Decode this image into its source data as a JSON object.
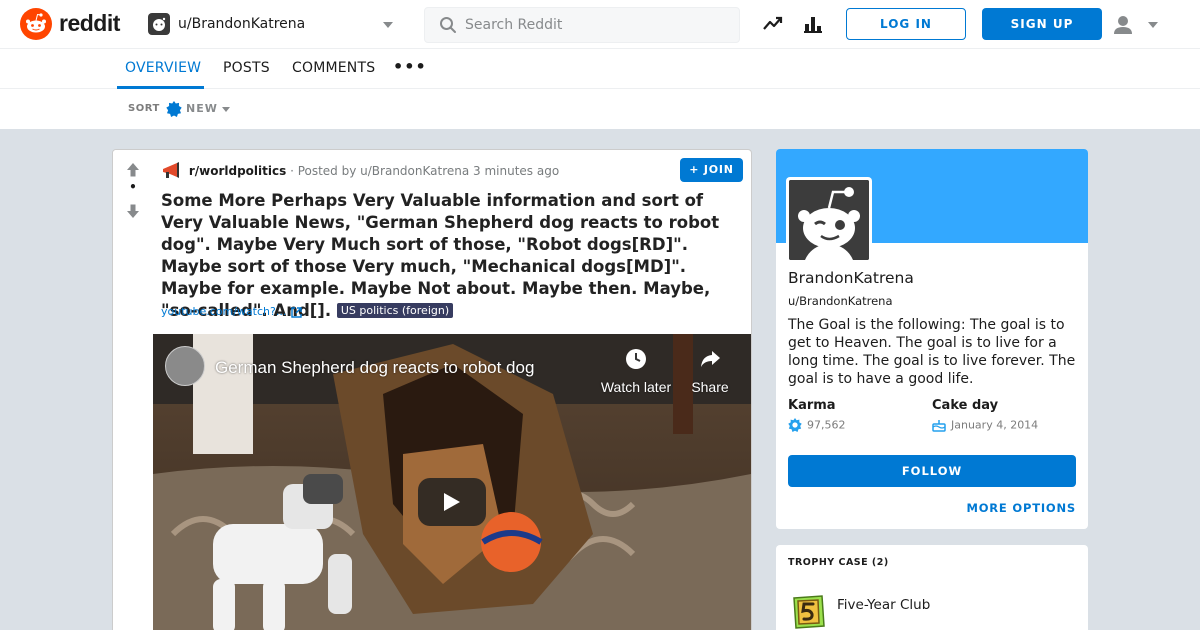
{
  "header": {
    "logo_text": "reddit",
    "current_user": "u/BrandonKatrena",
    "search_placeholder": "Search Reddit",
    "login_label": "LOG IN",
    "signup_label": "SIGN UP"
  },
  "tabs": {
    "items": [
      "OVERVIEW",
      "POSTS",
      "COMMENTS"
    ],
    "active": "OVERVIEW",
    "more": "•••"
  },
  "sort": {
    "label": "SORT",
    "value": "NEW"
  },
  "post": {
    "score": "•",
    "subreddit": "r/worldpolitics",
    "byline": " · Posted by u/BrandonKatrena 3 minutes ago",
    "join_label": "+ JOIN",
    "title": "Some More Perhaps Very Valuable information and sort of Very Valuable News, \"German Shepherd dog reacts to robot dog\". Maybe Very Much sort of those, \"Robot dogs[RD]\". Maybe sort of those Very much, \"Mechanical dogs[MD]\". Maybe for example. Maybe Not about. Maybe then. Maybe, \"so-called\". And[].",
    "flair": "US politics (foreign)",
    "link_text": "youtube.com/watch?...",
    "video": {
      "title": "German Shepherd dog reacts to robot dog",
      "watch_later": "Watch later",
      "share": "Share"
    }
  },
  "profile": {
    "display_name": "BrandonKatrena",
    "handle": "u/BrandonKatrena",
    "description": "The Goal is the following: The goal is to get to Heaven. The goal is to live for a long time. The goal is to live forever. The goal is to have a good life.",
    "karma_label": "Karma",
    "karma_value": "97,562",
    "cakeday_label": "Cake day",
    "cakeday_value": "January 4, 2014",
    "follow_label": "FOLLOW",
    "more_options_label": "MORE OPTIONS",
    "banner_color": "#33a8ff"
  },
  "trophy_case": {
    "heading": "TROPHY CASE (2)",
    "items": [
      {
        "name": "Five-Year Club",
        "icon": "five-year-club-icon"
      }
    ]
  },
  "colors": {
    "accent": "#0079d3",
    "brand": "#ff4500",
    "flair_bg": "#373c60"
  }
}
